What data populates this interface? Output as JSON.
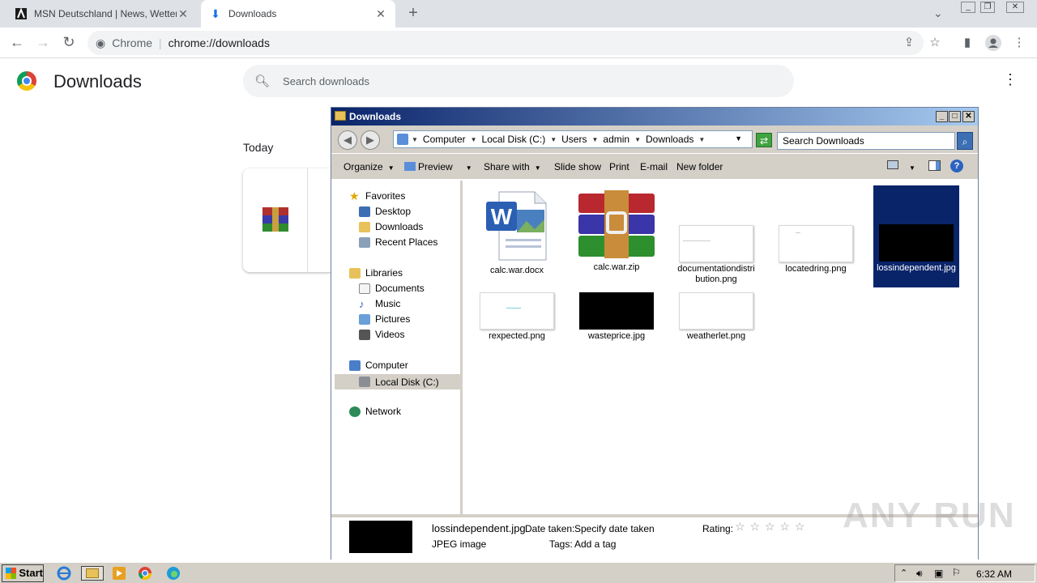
{
  "browser": {
    "tabs": [
      {
        "title": "MSN Deutschland | News, Wetter, St",
        "active": false
      },
      {
        "title": "Downloads",
        "active": true
      }
    ],
    "omnibox": {
      "site": "Chrome",
      "url": "chrome://downloads"
    }
  },
  "downloads_page": {
    "title": "Downloads",
    "search_placeholder": "Search downloads",
    "section": "Today"
  },
  "explorer": {
    "title": "Downloads",
    "breadcrumb": [
      "Computer",
      "Local Disk (C:)",
      "Users",
      "admin",
      "Downloads"
    ],
    "search_placeholder": "Search Downloads",
    "commands": [
      "Organize",
      "Preview",
      "Share with",
      "Slide show",
      "Print",
      "E-mail",
      "New folder"
    ],
    "nav": {
      "favorites": "Favorites",
      "favorites_items": [
        "Desktop",
        "Downloads",
        "Recent Places"
      ],
      "libraries": "Libraries",
      "libraries_items": [
        "Documents",
        "Music",
        "Pictures",
        "Videos"
      ],
      "computer": "Computer",
      "computer_items": [
        "Local Disk (C:)"
      ],
      "network": "Network"
    },
    "files": [
      {
        "name": "calc.war.docx",
        "type": "docx"
      },
      {
        "name": "calc.war.zip",
        "type": "rar"
      },
      {
        "name": "documentationdistribution.png",
        "type": "white"
      },
      {
        "name": "locatedring.png",
        "type": "white"
      },
      {
        "name": "lossindependent.jpg",
        "type": "black",
        "selected": true
      },
      {
        "name": "rexpected.png",
        "type": "white"
      },
      {
        "name": "wasteprice.jpg",
        "type": "black"
      },
      {
        "name": "weatherlet.png",
        "type": "white"
      }
    ],
    "details": {
      "filename": "lossindependent.jpg",
      "filetype": "JPEG image",
      "date_label": "Date taken:",
      "date_value": "Specify date taken",
      "tags_label": "Tags:",
      "tags_value": "Add a tag",
      "rating_label": "Rating:",
      "rating_stars": "☆ ☆ ☆ ☆ ☆"
    }
  },
  "taskbar": {
    "start_label": "Start",
    "clock": "6:32 AM"
  },
  "watermark": "ANY RUN"
}
